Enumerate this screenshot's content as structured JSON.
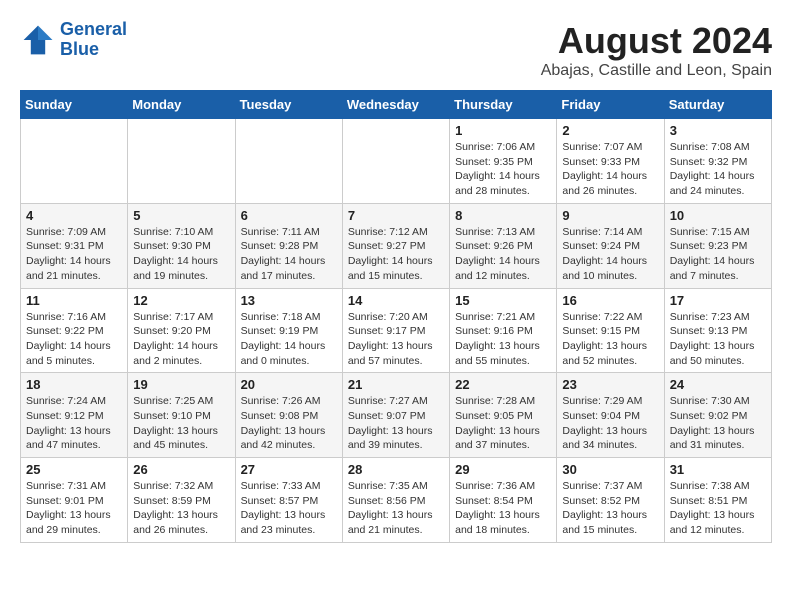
{
  "header": {
    "logo_line1": "General",
    "logo_line2": "Blue",
    "month_year": "August 2024",
    "location": "Abajas, Castille and Leon, Spain"
  },
  "days_of_week": [
    "Sunday",
    "Monday",
    "Tuesday",
    "Wednesday",
    "Thursday",
    "Friday",
    "Saturday"
  ],
  "weeks": [
    [
      {
        "day": "",
        "info": ""
      },
      {
        "day": "",
        "info": ""
      },
      {
        "day": "",
        "info": ""
      },
      {
        "day": "",
        "info": ""
      },
      {
        "day": "1",
        "info": "Sunrise: 7:06 AM\nSunset: 9:35 PM\nDaylight: 14 hours\nand 28 minutes."
      },
      {
        "day": "2",
        "info": "Sunrise: 7:07 AM\nSunset: 9:33 PM\nDaylight: 14 hours\nand 26 minutes."
      },
      {
        "day": "3",
        "info": "Sunrise: 7:08 AM\nSunset: 9:32 PM\nDaylight: 14 hours\nand 24 minutes."
      }
    ],
    [
      {
        "day": "4",
        "info": "Sunrise: 7:09 AM\nSunset: 9:31 PM\nDaylight: 14 hours\nand 21 minutes."
      },
      {
        "day": "5",
        "info": "Sunrise: 7:10 AM\nSunset: 9:30 PM\nDaylight: 14 hours\nand 19 minutes."
      },
      {
        "day": "6",
        "info": "Sunrise: 7:11 AM\nSunset: 9:28 PM\nDaylight: 14 hours\nand 17 minutes."
      },
      {
        "day": "7",
        "info": "Sunrise: 7:12 AM\nSunset: 9:27 PM\nDaylight: 14 hours\nand 15 minutes."
      },
      {
        "day": "8",
        "info": "Sunrise: 7:13 AM\nSunset: 9:26 PM\nDaylight: 14 hours\nand 12 minutes."
      },
      {
        "day": "9",
        "info": "Sunrise: 7:14 AM\nSunset: 9:24 PM\nDaylight: 14 hours\nand 10 minutes."
      },
      {
        "day": "10",
        "info": "Sunrise: 7:15 AM\nSunset: 9:23 PM\nDaylight: 14 hours\nand 7 minutes."
      }
    ],
    [
      {
        "day": "11",
        "info": "Sunrise: 7:16 AM\nSunset: 9:22 PM\nDaylight: 14 hours\nand 5 minutes."
      },
      {
        "day": "12",
        "info": "Sunrise: 7:17 AM\nSunset: 9:20 PM\nDaylight: 14 hours\nand 2 minutes."
      },
      {
        "day": "13",
        "info": "Sunrise: 7:18 AM\nSunset: 9:19 PM\nDaylight: 14 hours\nand 0 minutes."
      },
      {
        "day": "14",
        "info": "Sunrise: 7:20 AM\nSunset: 9:17 PM\nDaylight: 13 hours\nand 57 minutes."
      },
      {
        "day": "15",
        "info": "Sunrise: 7:21 AM\nSunset: 9:16 PM\nDaylight: 13 hours\nand 55 minutes."
      },
      {
        "day": "16",
        "info": "Sunrise: 7:22 AM\nSunset: 9:15 PM\nDaylight: 13 hours\nand 52 minutes."
      },
      {
        "day": "17",
        "info": "Sunrise: 7:23 AM\nSunset: 9:13 PM\nDaylight: 13 hours\nand 50 minutes."
      }
    ],
    [
      {
        "day": "18",
        "info": "Sunrise: 7:24 AM\nSunset: 9:12 PM\nDaylight: 13 hours\nand 47 minutes."
      },
      {
        "day": "19",
        "info": "Sunrise: 7:25 AM\nSunset: 9:10 PM\nDaylight: 13 hours\nand 45 minutes."
      },
      {
        "day": "20",
        "info": "Sunrise: 7:26 AM\nSunset: 9:08 PM\nDaylight: 13 hours\nand 42 minutes."
      },
      {
        "day": "21",
        "info": "Sunrise: 7:27 AM\nSunset: 9:07 PM\nDaylight: 13 hours\nand 39 minutes."
      },
      {
        "day": "22",
        "info": "Sunrise: 7:28 AM\nSunset: 9:05 PM\nDaylight: 13 hours\nand 37 minutes."
      },
      {
        "day": "23",
        "info": "Sunrise: 7:29 AM\nSunset: 9:04 PM\nDaylight: 13 hours\nand 34 minutes."
      },
      {
        "day": "24",
        "info": "Sunrise: 7:30 AM\nSunset: 9:02 PM\nDaylight: 13 hours\nand 31 minutes."
      }
    ],
    [
      {
        "day": "25",
        "info": "Sunrise: 7:31 AM\nSunset: 9:01 PM\nDaylight: 13 hours\nand 29 minutes."
      },
      {
        "day": "26",
        "info": "Sunrise: 7:32 AM\nSunset: 8:59 PM\nDaylight: 13 hours\nand 26 minutes."
      },
      {
        "day": "27",
        "info": "Sunrise: 7:33 AM\nSunset: 8:57 PM\nDaylight: 13 hours\nand 23 minutes."
      },
      {
        "day": "28",
        "info": "Sunrise: 7:35 AM\nSunset: 8:56 PM\nDaylight: 13 hours\nand 21 minutes."
      },
      {
        "day": "29",
        "info": "Sunrise: 7:36 AM\nSunset: 8:54 PM\nDaylight: 13 hours\nand 18 minutes."
      },
      {
        "day": "30",
        "info": "Sunrise: 7:37 AM\nSunset: 8:52 PM\nDaylight: 13 hours\nand 15 minutes."
      },
      {
        "day": "31",
        "info": "Sunrise: 7:38 AM\nSunset: 8:51 PM\nDaylight: 13 hours\nand 12 minutes."
      }
    ]
  ]
}
